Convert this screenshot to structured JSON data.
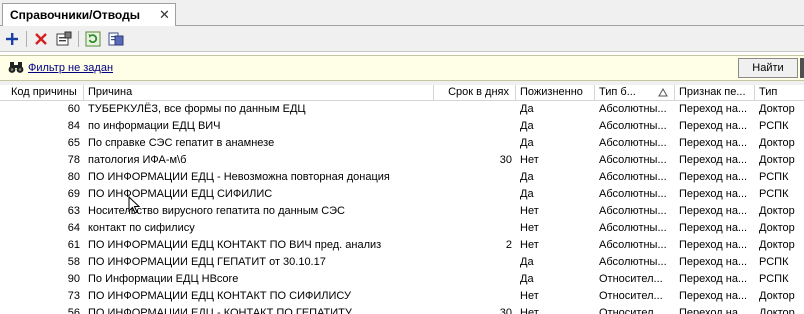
{
  "tab": {
    "title": "Справочники/Отводы",
    "close": "✕"
  },
  "toolbar": {
    "icons": [
      "add-icon",
      "delete-icon",
      "properties-icon",
      "refresh-icon",
      "export-icon"
    ]
  },
  "filter": {
    "text": "Фильтр не задан",
    "find_label": "Найти"
  },
  "grid": {
    "columns": [
      "Код причины",
      "Причина",
      "Срок в днях",
      "Пожизненно",
      "Тип б...",
      "Признак пе...",
      "Тип"
    ],
    "sorted_column": "Тип б...",
    "rows": [
      {
        "code": "60",
        "reason": "ТУБЕРКУЛЁЗ, все формы по данным ЕДЦ",
        "days": "",
        "lifelong": "Да",
        "type_b": "Абсолютны...",
        "sign": "Переход на...",
        "type": "Доктор"
      },
      {
        "code": "84",
        "reason": "по информации ЕДЦ ВИЧ",
        "days": "",
        "lifelong": "Да",
        "type_b": "Абсолютны...",
        "sign": "Переход на...",
        "type": "РСПК"
      },
      {
        "code": "65",
        "reason": "По справке СЭС гепатит в анамнезе",
        "days": "",
        "lifelong": "Да",
        "type_b": "Абсолютны...",
        "sign": "Переход на...",
        "type": "Доктор"
      },
      {
        "code": "78",
        "reason": "патология ИФА-м\\б",
        "days": "30",
        "lifelong": "Нет",
        "type_b": "Абсолютны...",
        "sign": "Переход на...",
        "type": "Доктор"
      },
      {
        "code": "80",
        "reason": "ПО ИНФОРМАЦИИ ЕДЦ - Невозможна повторная донация",
        "days": "",
        "lifelong": "Да",
        "type_b": "Абсолютны...",
        "sign": "Переход на...",
        "type": "РСПК"
      },
      {
        "code": "69",
        "reason": "ПО ИНФОРМАЦИИ ЕДЦ СИФИЛИС",
        "days": "",
        "lifelong": "Да",
        "type_b": "Абсолютны...",
        "sign": "Переход на...",
        "type": "РСПК"
      },
      {
        "code": "63",
        "reason": "Носительство вирусного гепатита по данным СЭС",
        "days": "",
        "lifelong": "Нет",
        "type_b": "Абсолютны...",
        "sign": "Переход на...",
        "type": "Доктор"
      },
      {
        "code": "64",
        "reason": "контакт по сифилису",
        "days": "",
        "lifelong": "Нет",
        "type_b": "Абсолютны...",
        "sign": "Переход на...",
        "type": "Доктор"
      },
      {
        "code": "61",
        "reason": "ПО ИНФОРМАЦИИ ЕДЦ КОНТАКТ ПО ВИЧ пред. анализ",
        "days": "2",
        "lifelong": "Нет",
        "type_b": "Абсолютны...",
        "sign": "Переход на...",
        "type": "Доктор"
      },
      {
        "code": "58",
        "reason": "ПО ИНФОРМАЦИИ ЕДЦ ГЕПАТИТ  от 30.10.17",
        "days": "",
        "lifelong": "Да",
        "type_b": "Абсолютны...",
        "sign": "Переход на...",
        "type": "РСПК"
      },
      {
        "code": "90",
        "reason": "По Информации ЕДЦ HBcore",
        "days": "",
        "lifelong": "Да",
        "type_b": "Относител...",
        "sign": "Переход на...",
        "type": "РСПК"
      },
      {
        "code": "73",
        "reason": "ПО ИНФОРМАЦИИ ЕДЦ КОНТАКТ ПО СИФИЛИСУ",
        "days": "",
        "lifelong": "Нет",
        "type_b": "Относител...",
        "sign": "Переход на...",
        "type": "Доктор"
      },
      {
        "code": "56",
        "reason": "ПО ИНФОРМАЦИИ ЕДЦ - КОНТАКТ ПО ГЕПАТИТУ",
        "days": "30",
        "lifelong": "Нет",
        "type_b": "Относител...",
        "sign": "Переход на...",
        "type": "Доктор"
      }
    ]
  }
}
